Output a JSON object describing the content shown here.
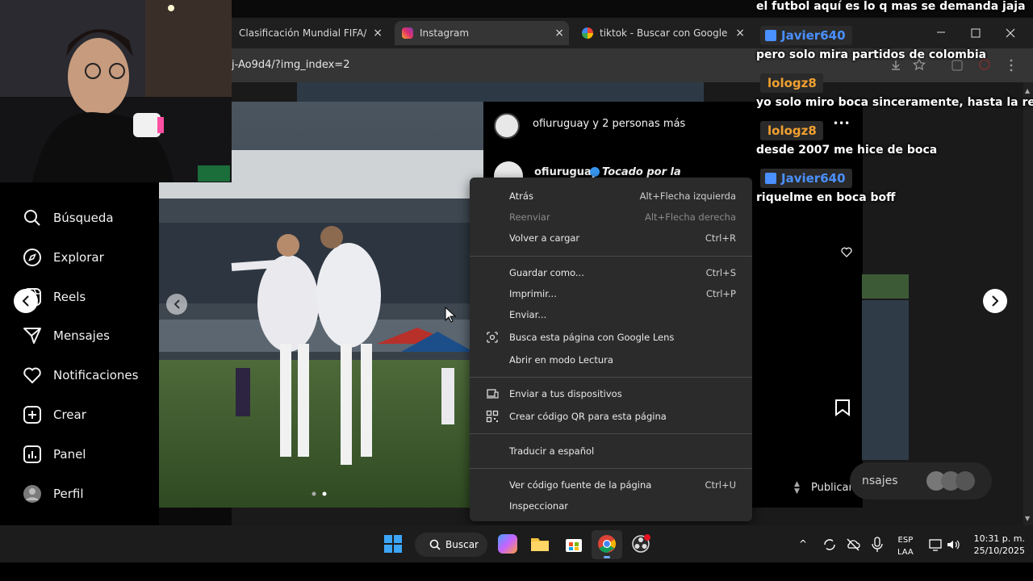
{
  "browser": {
    "tabs": [
      {
        "title": "Clasificación Mundial FIFA/Coc",
        "active": false
      },
      {
        "title": "Instagram",
        "active": true
      },
      {
        "title": "tiktok - Buscar con Google",
        "active": false
      }
    ],
    "url": "j-Ao9d4/?img_index=2",
    "close_glyph": "×"
  },
  "instagram": {
    "nav": [
      {
        "label": "Búsqueda",
        "icon": "search-icon"
      },
      {
        "label": "Explorar",
        "icon": "compass-icon"
      },
      {
        "label": "Reels",
        "icon": "reels-icon"
      },
      {
        "label": "Mensajes",
        "icon": "send-icon"
      },
      {
        "label": "Notificaciones",
        "icon": "heart-icon"
      },
      {
        "label": "Crear",
        "icon": "plus-square-icon"
      },
      {
        "label": "Panel",
        "icon": "chart-icon"
      },
      {
        "label": "Perfil",
        "icon": "avatar-icon"
      }
    ],
    "post": {
      "header_text": "ofiuruguay y 2 personas más",
      "author": "ofiuruguay",
      "caption_preview": "Tocado por la",
      "more_glyph": "•••",
      "publish_label": "Publicar",
      "messages_partial": "nsajes"
    }
  },
  "context_menu": {
    "groups": [
      [
        {
          "label": "Atrás",
          "shortcut": "Alt+Flecha izquierda",
          "disabled": false
        },
        {
          "label": "Reenviar",
          "shortcut": "Alt+Flecha derecha",
          "disabled": true
        },
        {
          "label": "Volver a cargar",
          "shortcut": "Ctrl+R",
          "disabled": false
        }
      ],
      [
        {
          "label": "Guardar como...",
          "shortcut": "Ctrl+S",
          "disabled": false
        },
        {
          "label": "Imprimir...",
          "shortcut": "Ctrl+P",
          "disabled": false
        },
        {
          "label": "Enviar...",
          "shortcut": "",
          "disabled": false
        },
        {
          "label": "Busca esta página con Google Lens",
          "shortcut": "",
          "disabled": false
        },
        {
          "label": "Abrir en modo Lectura",
          "shortcut": "",
          "disabled": false
        }
      ],
      [
        {
          "label": "Enviar a tus dispositivos",
          "shortcut": "",
          "disabled": false
        },
        {
          "label": "Crear código QR para esta página",
          "shortcut": "",
          "disabled": false
        }
      ],
      [
        {
          "label": "Traducir a español",
          "shortcut": "",
          "disabled": false
        }
      ],
      [
        {
          "label": "Ver código fuente de la página",
          "shortcut": "Ctrl+U",
          "disabled": false
        },
        {
          "label": "Inspeccionar",
          "shortcut": "",
          "disabled": false
        }
      ]
    ]
  },
  "chat": {
    "top_line": "el futbol aquí es lo q mas se demanda jaja",
    "messages": [
      {
        "user": "Javier640",
        "color": "#4a90ff",
        "badge": true,
        "text": "pero solo mira partidos de colombia"
      },
      {
        "user": "lologz8",
        "color": "#f0a030",
        "badge": false,
        "text": "yo solo miro boca sinceramente, hasta la reserva j"
      },
      {
        "user": "lologz8",
        "color": "#f0a030",
        "badge": false,
        "text": "desde 2007 me hice de boca"
      },
      {
        "user": "Javier640",
        "color": "#4a90ff",
        "badge": true,
        "text": "riquelme en boca boff"
      }
    ]
  },
  "taskbar": {
    "search_label": "Buscar",
    "lang": "ESP",
    "layout": "LAA",
    "time": "10:31 p. m.",
    "date": "25/10/2025"
  }
}
